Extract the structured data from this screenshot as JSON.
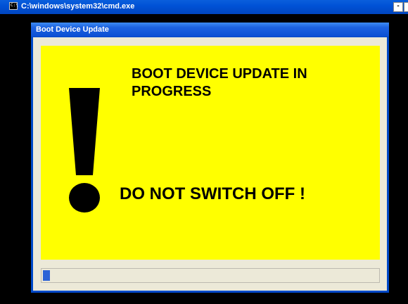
{
  "console_window": {
    "title": "C:\\windows\\system32\\cmd.exe",
    "icon": "console-icon",
    "icon_text": "C:\\",
    "minimize_label": "-"
  },
  "dialog": {
    "title": "Boot Device Update",
    "messages": {
      "line1": "BOOT DEVICE UPDATE IN",
      "line2": "PROGRESS",
      "line3": "DO NOT SWITCH OFF !"
    },
    "warning_icon": "exclamation-icon",
    "progress_fraction": 0.02
  },
  "colors": {
    "panel_background": "#ffff00",
    "dialog_border": "#0049c8",
    "progress_fill": "#2b62d6",
    "titlebar": "#0052d6"
  }
}
